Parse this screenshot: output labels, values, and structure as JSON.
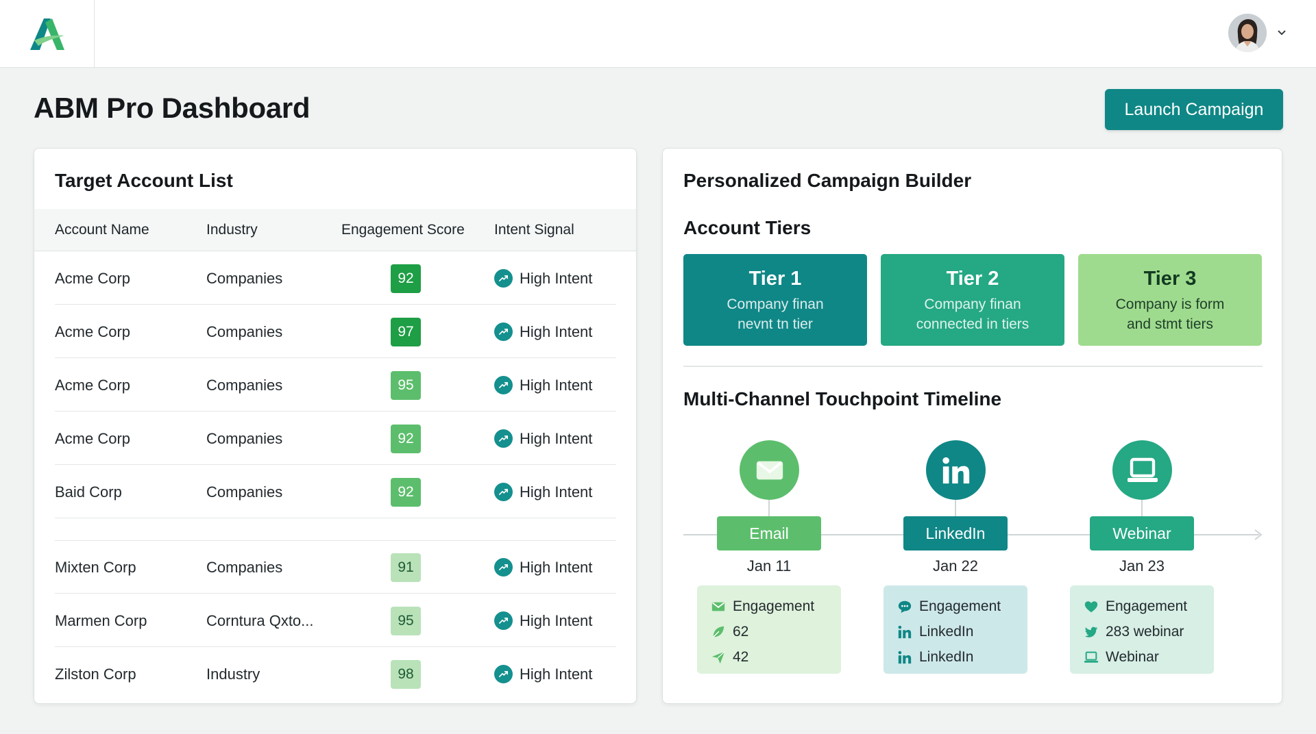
{
  "header": {
    "logo_icon": "brand-a-logo-icon",
    "user_avatar_icon": "user-avatar",
    "menu_icon": "chevron-down-icon"
  },
  "page": {
    "title": "ABM Pro Dashboard",
    "launch_label": "Launch Campaign"
  },
  "accounts": {
    "title": "Target Account List",
    "columns": [
      "Account Name",
      "Industry",
      "Engagement Score",
      "Intent Signal"
    ],
    "rows": [
      {
        "name": "Acme Corp",
        "industry": "Companies",
        "score": "92",
        "intent": "High Intent"
      },
      {
        "name": "Acme Corp",
        "industry": "Companies",
        "score": "97",
        "intent": "High Intent"
      },
      {
        "name": "Acme Corp",
        "industry": "Companies",
        "score": "95",
        "intent": "High Intent"
      },
      {
        "name": "Acme Corp",
        "industry": "Companies",
        "score": "92",
        "intent": "High Intent"
      },
      {
        "name": "Baid Corp",
        "industry": "Companies",
        "score": "92",
        "intent": "High Intent"
      },
      {
        "name": "Mixten Corp",
        "industry": "Companies",
        "score": "91",
        "intent": "High Intent"
      },
      {
        "name": "Marmen Corp",
        "industry": "Corntura Qxto...",
        "score": "95",
        "intent": "High Intent"
      },
      {
        "name": "Zilston Corp",
        "industry": "Industry",
        "score": "98",
        "intent": "High Intent"
      }
    ],
    "score_colors": [
      "#1e9e45",
      "#1e9e45",
      "#5cbe6c",
      "#5cbe6c",
      "#5cbe6c",
      "#b9e2b9",
      "#b9e2b9",
      "#b9e2b9"
    ],
    "intent_icon": "trending-up-icon"
  },
  "campaign": {
    "title": "Personalized Campaign Builder",
    "tiers_title": "Account Tiers",
    "tiers": [
      {
        "name": "Tier 1",
        "line1": "Company finan",
        "line2": "nevnt tn tier",
        "color": "#0f8786"
      },
      {
        "name": "Tier 2",
        "line1": "Company finan",
        "line2": "connected in tiers",
        "color": "#25a884"
      },
      {
        "name": "Tier 3",
        "line1": "Company is form",
        "line2": "and stmt tiers",
        "color": "#9fdb8e"
      }
    ],
    "timeline_title": "Multi-Channel Touchpoint Timeline",
    "touchpoints": [
      {
        "channel": "Email",
        "date": "Jan 11",
        "icon": "mail-icon",
        "items": [
          {
            "icon": "mail-icon",
            "text": "Engagement"
          },
          {
            "icon": "leaf-icon",
            "text": "62"
          },
          {
            "icon": "send-icon",
            "text": "42"
          }
        ]
      },
      {
        "channel": "LinkedIn",
        "date": "Jan 22",
        "icon": "linkedin-icon",
        "items": [
          {
            "icon": "chat-icon",
            "text": "Engagement"
          },
          {
            "icon": "linkedin-icon",
            "text": "LinkedIn"
          },
          {
            "icon": "linkedin-icon",
            "text": "LinkedIn"
          }
        ]
      },
      {
        "channel": "Webinar",
        "date": "Jan 23",
        "icon": "laptop-icon",
        "items": [
          {
            "icon": "heart-icon",
            "text": "Engagement"
          },
          {
            "icon": "twitter-bird-icon",
            "text": "283 webinar"
          },
          {
            "icon": "laptop-icon",
            "text": "Webinar"
          }
        ]
      }
    ]
  }
}
